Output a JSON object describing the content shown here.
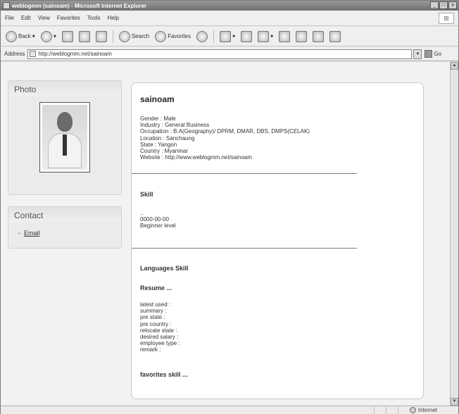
{
  "window": {
    "title": "weblogmm (sainoam) - Microsoft Internet Explorer",
    "controls": [
      "_",
      "□",
      "x"
    ]
  },
  "menubar": {
    "items": [
      "File",
      "Edit",
      "View",
      "Favorites",
      "Tools",
      "Help"
    ]
  },
  "toolbar": {
    "back_label": "Back",
    "search_label": "Search",
    "favorites_label": "Favorites"
  },
  "addressbar": {
    "label": "Address",
    "url": "http://weblogmm.net/sainoam",
    "go_label": "Go"
  },
  "photo_panel": {
    "title": "Photo"
  },
  "contact_panel": {
    "title": "Contact",
    "email_link": "Email",
    "bullet": "-"
  },
  "profile": {
    "name": "sainoam",
    "details": [
      "Gender : Male",
      "Industry : General Business",
      "Occupation : B.A(Geography)/ DPRM, DMAR, DBS, DMPS(CELAK)",
      "Location : Sanchaung",
      "State : Yangon",
      "Country : Myanmar",
      "Website : http://www.weblogmm.net/sainoam"
    ]
  },
  "skill": {
    "title": "Skill",
    "lines": [
      "..",
      "0000-00-00",
      "Beginner  level"
    ]
  },
  "languages": {
    "title": "Languages Skill"
  },
  "resume": {
    "title": "Resume ...",
    "fields": [
      "latest used :",
      "summary :",
      "pre state :",
      "pre country :",
      "relocate state :",
      "desired salary :",
      "employee type :",
      "remark :"
    ]
  },
  "favorites": {
    "title": "favorites skill ..."
  },
  "statusbar": {
    "zone": "Internet"
  }
}
